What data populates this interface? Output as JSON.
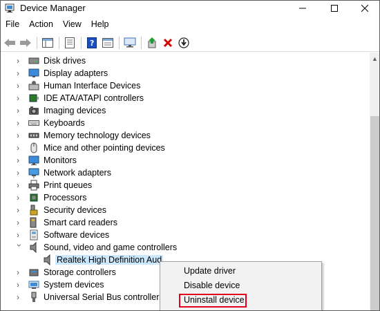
{
  "window": {
    "title": "Device Manager",
    "controls": [
      "minimize",
      "maximize",
      "close"
    ]
  },
  "menubar": {
    "items": [
      "File",
      "Action",
      "View",
      "Help"
    ]
  },
  "toolbar": {
    "buttons": [
      "back-icon",
      "forward-icon",
      "properties-icon",
      "help-icon",
      "view-icon",
      "monitor-icon",
      "update-driver-icon",
      "uninstall-icon",
      "download-icon"
    ],
    "colors": {
      "uninstall": "#d40000",
      "update": "#1f9c2f"
    }
  },
  "tree": {
    "items": [
      {
        "label": "Disk drives",
        "icon": "disk-drive-icon",
        "expanded": false
      },
      {
        "label": "Display adapters",
        "icon": "display-adapter-icon",
        "expanded": false
      },
      {
        "label": "Human Interface Devices",
        "icon": "hid-icon",
        "expanded": false
      },
      {
        "label": "IDE ATA/ATAPI controllers",
        "icon": "ide-controller-icon",
        "expanded": false
      },
      {
        "label": "Imaging devices",
        "icon": "camera-icon",
        "expanded": false
      },
      {
        "label": "Keyboards",
        "icon": "keyboard-icon",
        "expanded": false
      },
      {
        "label": "Memory technology devices",
        "icon": "memory-icon",
        "expanded": false
      },
      {
        "label": "Mice and other pointing devices",
        "icon": "mouse-icon",
        "expanded": false
      },
      {
        "label": "Monitors",
        "icon": "monitor-icon",
        "expanded": false
      },
      {
        "label": "Network adapters",
        "icon": "network-icon",
        "expanded": false
      },
      {
        "label": "Print queues",
        "icon": "printer-icon",
        "expanded": false
      },
      {
        "label": "Processors",
        "icon": "processor-icon",
        "expanded": false
      },
      {
        "label": "Security devices",
        "icon": "security-icon",
        "expanded": false
      },
      {
        "label": "Smart card readers",
        "icon": "smart-card-icon",
        "expanded": false
      },
      {
        "label": "Software devices",
        "icon": "software-device-icon",
        "expanded": false
      },
      {
        "label": "Sound, video and game controllers",
        "icon": "speaker-icon",
        "expanded": true
      },
      {
        "label": "Realtek High Definition Aud",
        "icon": "speaker-icon",
        "child": true,
        "selected": true
      },
      {
        "label": "Storage controllers",
        "icon": "storage-icon",
        "expanded": false
      },
      {
        "label": "System devices",
        "icon": "system-icon",
        "expanded": false
      },
      {
        "label": "Universal Serial Bus controllers",
        "icon": "usb-icon",
        "expanded": false
      }
    ]
  },
  "context_menu": {
    "items": [
      "Update driver",
      "Disable device",
      "Uninstall device"
    ],
    "highlighted": "Uninstall device",
    "highlight_color": "#e0001b"
  }
}
